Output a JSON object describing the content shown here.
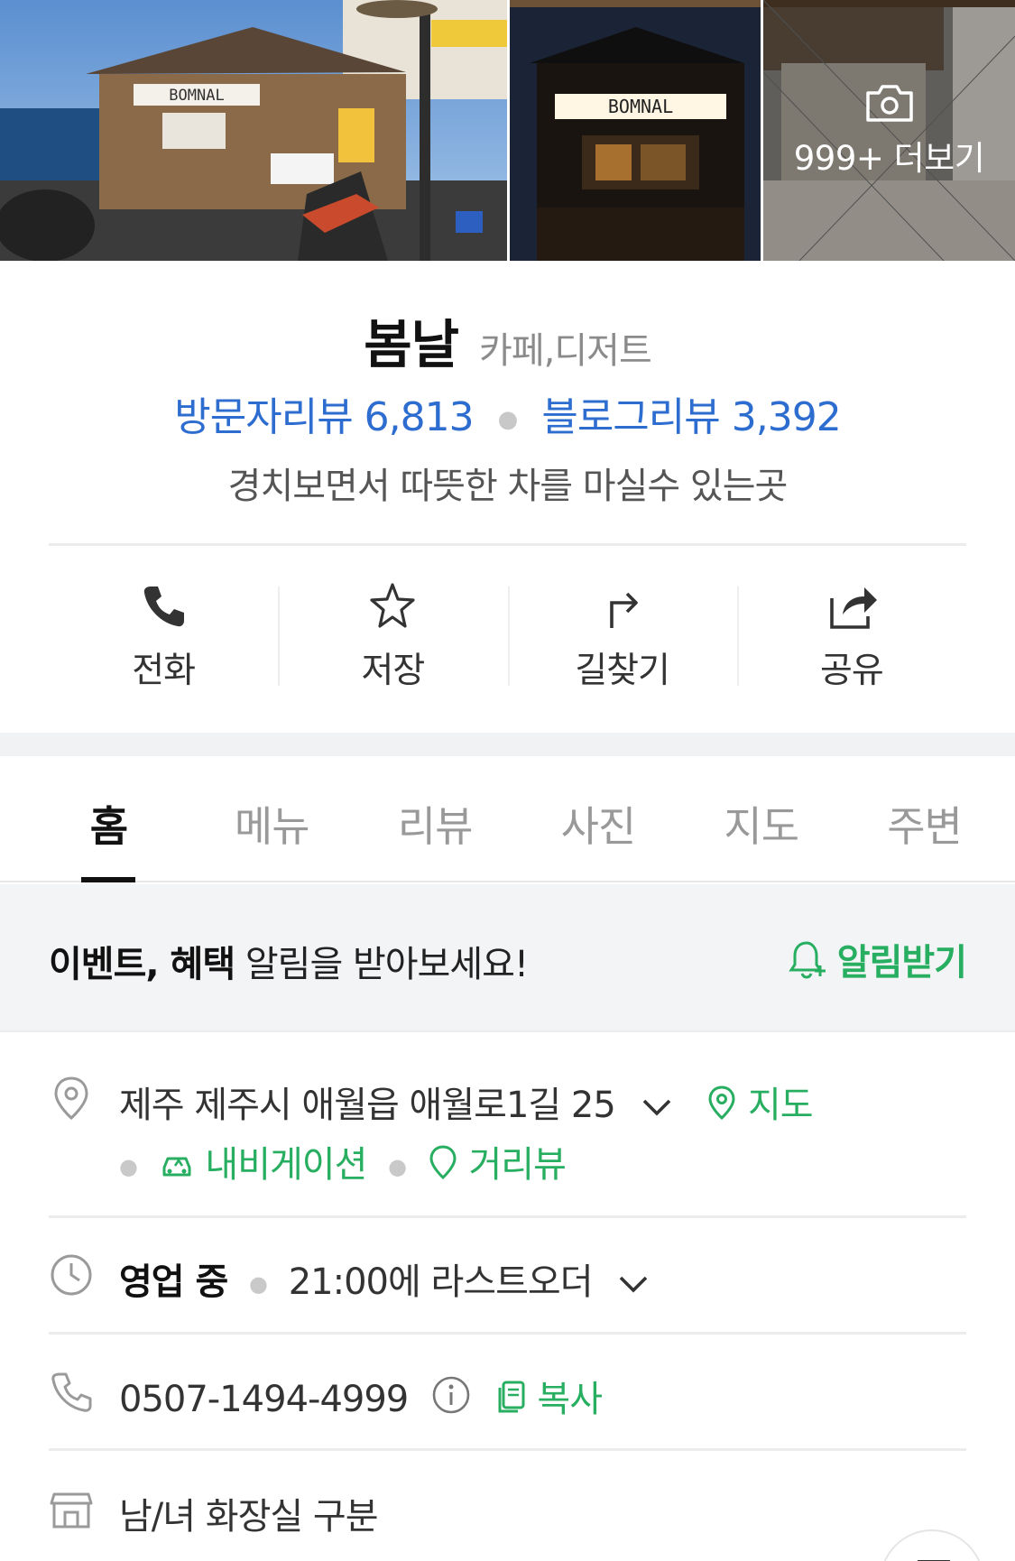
{
  "photos": {
    "main_sign": "BOMNAL",
    "night_sign": "BOMNAL",
    "more_label": "999+ 더보기"
  },
  "place": {
    "name": "봄날",
    "category": "카페,디저트",
    "visitor_reviews": "방문자리뷰 6,813",
    "blog_reviews": "블로그리뷰 3,392",
    "tagline": "경치보면서 따뜻한 차를 마실수 있는곳"
  },
  "actions": [
    {
      "label": "전화",
      "icon": "phone-icon"
    },
    {
      "label": "저장",
      "icon": "star-icon"
    },
    {
      "label": "길찾기",
      "icon": "directions-icon"
    },
    {
      "label": "공유",
      "icon": "share-icon"
    }
  ],
  "tabs": [
    "홈",
    "메뉴",
    "리뷰",
    "사진",
    "지도",
    "주변"
  ],
  "active_tab": "홈",
  "banner": {
    "bold_text": "이벤트, 혜택",
    "text": " 알림을 받아보세요!",
    "action": "알림받기"
  },
  "info": {
    "address": "제주 제주시 애월읍 애월로1길 25",
    "map_link": "지도",
    "navigation_link": "내비게이션",
    "street_view_link": "거리뷰",
    "status": "영업 중",
    "last_order": "21:00에 라스트오더",
    "phone": "0507-1494-4999",
    "copy_label": "복사",
    "restroom": "남/녀 화장실 구분"
  },
  "colors": {
    "link_blue": "#2e6dd0",
    "accent_green": "#27ae60"
  }
}
